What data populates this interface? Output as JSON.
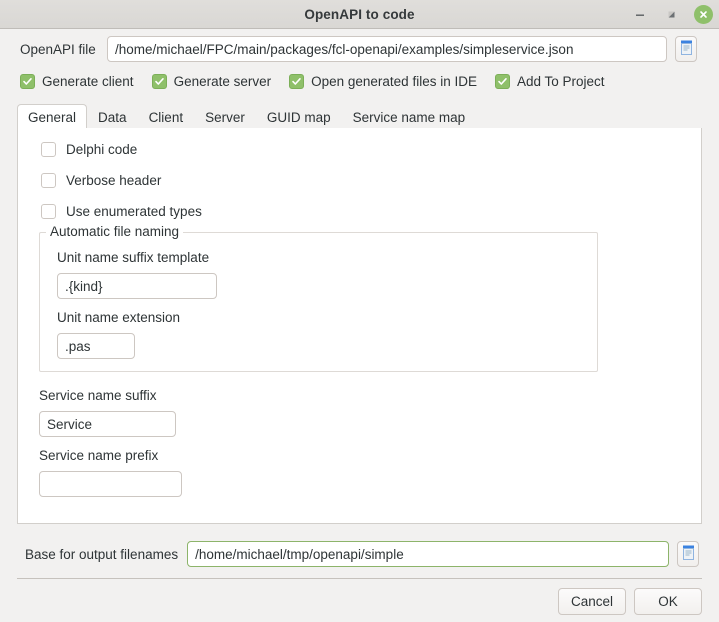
{
  "window": {
    "title": "OpenAPI to code",
    "controls": {
      "minimize": "minimize-icon",
      "maximize": "maximize-icon",
      "close": "close-icon"
    },
    "close_color": "#8fc06a"
  },
  "file_row": {
    "label": "OpenAPI file",
    "value": "/home/michael/FPC/main/packages/fcl-openapi/examples/simpleservice.json",
    "placeholder": "",
    "browse_icon": "document-browse-icon"
  },
  "top_checkboxes": [
    {
      "label": "Generate client",
      "checked": true
    },
    {
      "label": "Generate server",
      "checked": true
    },
    {
      "label": "Open generated files in IDE",
      "checked": true
    },
    {
      "label": "Add To Project",
      "checked": true
    }
  ],
  "tabs": [
    {
      "label": "General",
      "active": true
    },
    {
      "label": "Data",
      "active": false
    },
    {
      "label": "Client",
      "active": false
    },
    {
      "label": "Server",
      "active": false
    },
    {
      "label": "GUID map",
      "active": false
    },
    {
      "label": "Service name map",
      "active": false
    }
  ],
  "general_tab": {
    "checkboxes": [
      {
        "label": "Delphi code",
        "checked": false
      },
      {
        "label": "Verbose header",
        "checked": false
      },
      {
        "label": "Use enumerated types",
        "checked": false
      }
    ],
    "group": {
      "title": "Automatic file naming",
      "fields": [
        {
          "label": "Unit name suffix template",
          "value": ".{kind}"
        },
        {
          "label": "Unit name extension",
          "value": ".pas"
        }
      ]
    },
    "service_suffix": {
      "label": "Service name suffix",
      "value": "Service"
    },
    "service_prefix": {
      "label": "Service name prefix",
      "value": ""
    }
  },
  "base_row": {
    "label": "Base for output filenames",
    "value": "/home/michael/tmp/openapi/simple",
    "browse_icon": "document-browse-icon",
    "focused": true,
    "focus_color": "#8db46a"
  },
  "buttons": {
    "cancel": "Cancel",
    "ok": "OK"
  }
}
